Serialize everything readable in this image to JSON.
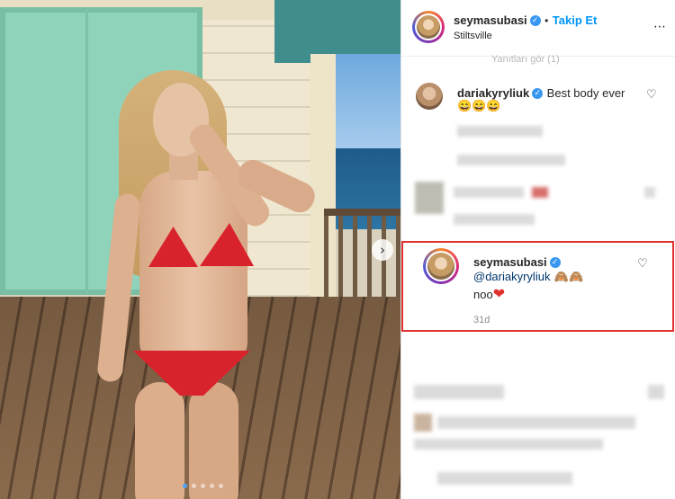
{
  "post": {
    "author": "seymasubasi",
    "follow_label": "Takip Et",
    "separator": "•",
    "location": "Stiltsville",
    "more_icon": "⋯"
  },
  "carousel": {
    "next_icon": "›",
    "slide_count": 5,
    "active_slide": 1
  },
  "comments": {
    "truncated_line": "Yanıtları gör (1)",
    "first": {
      "username": "dariakyryliuk",
      "text": "Best body ever",
      "emojis": "😄😄😄"
    },
    "reply": {
      "username": "seymasubasi",
      "mention": "@dariakyryliuk",
      "emojis": "🙈🙈",
      "text": "noo",
      "heart": "❤",
      "age": "31d"
    }
  },
  "icons": {
    "heart_outline": "♡",
    "verified": "✓"
  },
  "colors": {
    "link_blue": "#0095f6",
    "highlight_red": "#e0312f",
    "verified_blue": "#3897f0"
  }
}
